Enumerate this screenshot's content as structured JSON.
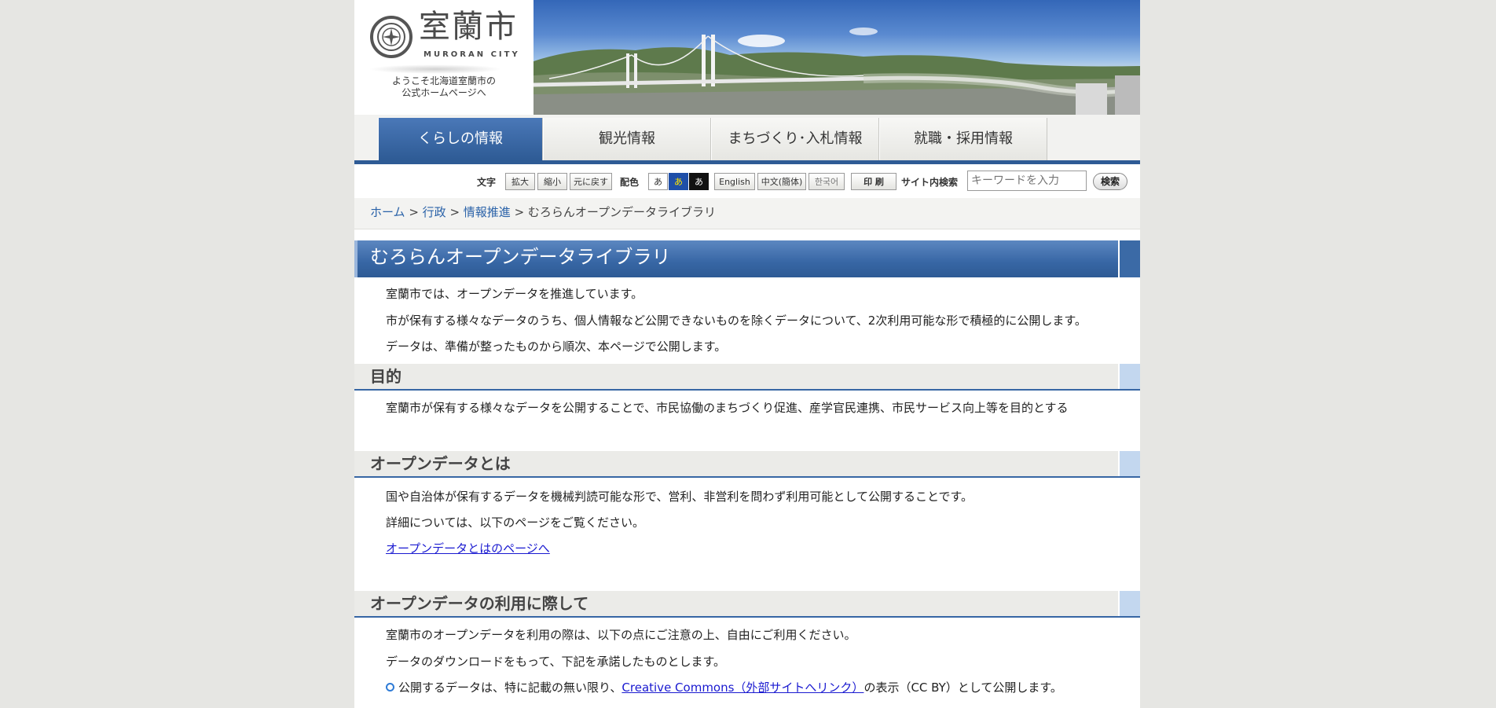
{
  "header": {
    "logo_text": "室蘭市",
    "logo_sub": "MURORAN CITY",
    "tagline_line1": "ようこそ北海道室蘭市の",
    "tagline_line2": "公式ホームページへ"
  },
  "nav": {
    "tabs": [
      {
        "label": "くらしの情報",
        "active": true
      },
      {
        "label": "観光情報",
        "active": false
      },
      {
        "label": "まちづくり･入札情報",
        "active": false
      },
      {
        "label": "就職・採用情報",
        "active": false
      }
    ]
  },
  "toolbar": {
    "text_size_label": "文字",
    "enlarge": "拡大",
    "shrink": "縮小",
    "reset": "元に戻す",
    "color_label": "配色",
    "color_options": [
      "あ",
      "あ",
      "あ"
    ],
    "english": "English",
    "chinese": "中文(簡体)",
    "korean": "한국어",
    "print": "印 刷",
    "search_label": "サイト内検索",
    "search_placeholder": "キーワードを入力",
    "search_button": "検索"
  },
  "breadcrumb": {
    "home": "ホーム",
    "sep": " > ",
    "level1": "行政",
    "level2": "情報推進",
    "current": "むろらんオープンデータライブラリ"
  },
  "main": {
    "title": "むろらんオープンデータライブラリ",
    "intro": [
      "室蘭市では、オープンデータを推進しています。",
      "市が保有する様々なデータのうち、個人情報など公開できないものを除くデータについて、2次利用可能な形で積極的に公開します。",
      "データは、準備が整ったものから順次、本ページで公開します。"
    ],
    "sections": {
      "purpose": {
        "heading": "目的",
        "text": "室蘭市が保有する様々なデータを公開することで、市民協働のまちづくり促進、産学官民連携、市民サービス向上等を目的とする"
      },
      "what_is": {
        "heading": "オープンデータとは",
        "text1": "国や自治体が保有するデータを機械判読可能な形で、営利、非営利を問わず利用可能として公開することです。",
        "text2": "詳細については、以下のページをご覧ください。",
        "link": "オープンデータとはのページへ"
      },
      "usage": {
        "heading": "オープンデータの利用に際して",
        "text1": "室蘭市のオープンデータを利用の際は、以下の点にご注意の上、自由にご利用ください。",
        "text2": "データのダウンロードをもって、下記を承諾したものとします。",
        "bullet_before": "公開するデータは、特に記載の無い限り、",
        "bullet_link": "Creative Commons（外部サイトへリンク）",
        "bullet_after": "の表示（CC BY）として公開します。"
      }
    }
  },
  "colors": {
    "accent": "#2e5b95",
    "link": "#1a1ad0",
    "breadcrumb_link": "#2a62a8",
    "background": "#e6e6e3"
  }
}
